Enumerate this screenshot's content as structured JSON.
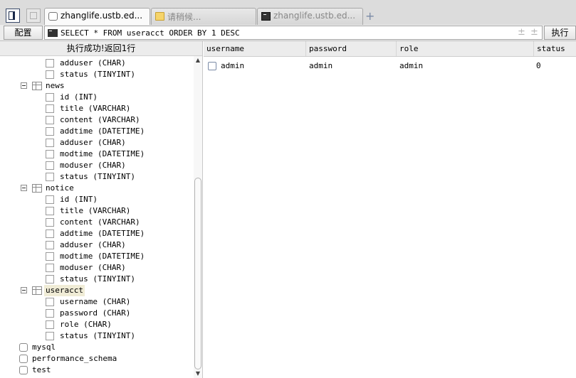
{
  "tabs": [
    {
      "label": "zhanglife.ustb.ed...",
      "icon": "database-icon",
      "active": true
    },
    {
      "label": "请稍候...",
      "icon": "folder-icon",
      "active": false
    },
    {
      "label": "zhanglife.ustb.ed...",
      "icon": "terminal-icon",
      "active": false
    }
  ],
  "toolbar": {
    "config_label": "配置",
    "sql": "SELECT * FROM useracct ORDER BY 1 DESC",
    "plus_sign": "±",
    "exec_label": "执行"
  },
  "status": "执行成功!返回1行",
  "tree": {
    "partial_columns": [
      "adduser (CHAR)",
      "status (TINYINT)"
    ],
    "tables": [
      {
        "name": "news",
        "columns": [
          "id (INT)",
          "title (VARCHAR)",
          "content (VARCHAR)",
          "addtime (DATETIME)",
          "adduser (CHAR)",
          "modtime (DATETIME)",
          "moduser (CHAR)",
          "status (TINYINT)"
        ]
      },
      {
        "name": "notice",
        "columns": [
          "id (INT)",
          "title (VARCHAR)",
          "content (VARCHAR)",
          "addtime (DATETIME)",
          "adduser (CHAR)",
          "modtime (DATETIME)",
          "moduser (CHAR)",
          "status (TINYINT)"
        ]
      },
      {
        "name": "useracct",
        "selected": true,
        "columns": [
          "username (CHAR)",
          "password (CHAR)",
          "role (CHAR)",
          "status (TINYINT)"
        ]
      }
    ],
    "databases": [
      "mysql",
      "performance_schema",
      "test"
    ]
  },
  "grid": {
    "columns": [
      "username",
      "password",
      "role",
      "status"
    ],
    "rows": [
      [
        "admin",
        "admin",
        "admin",
        "0"
      ]
    ]
  },
  "scroll": {
    "up_glyph": "▲",
    "down_glyph": "▼"
  }
}
